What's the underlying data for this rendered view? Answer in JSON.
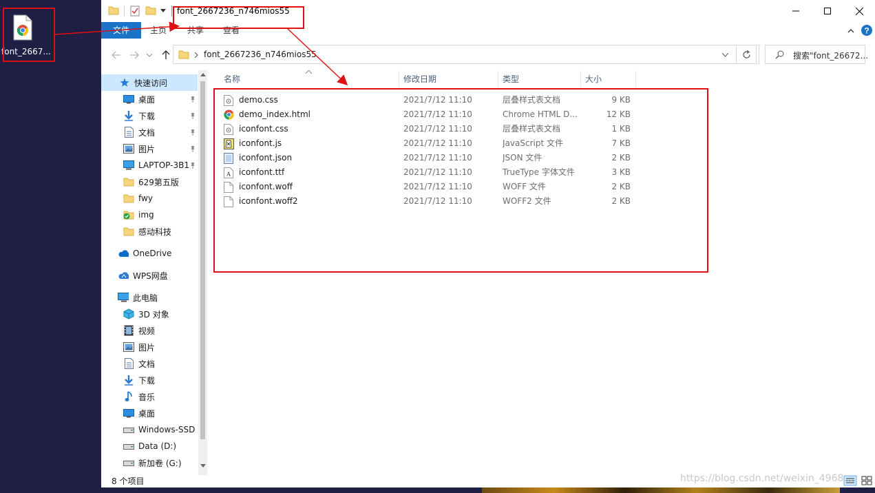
{
  "desktop": {
    "icon_label": "font_2667..."
  },
  "window": {
    "title": "font_2667236_n746mios55",
    "ribbon_tabs": [
      "文件",
      "主页",
      "共享",
      "查看"
    ],
    "address_path": "font_2667236_n746mios55",
    "search_placeholder": "搜索\"font_26672...",
    "nav_items": [
      {
        "label": "快速访问",
        "icon": "star-icon"
      },
      {
        "label": "桌面",
        "icon": "desktop-icon"
      },
      {
        "label": "下载",
        "icon": "download-icon"
      },
      {
        "label": "文档",
        "icon": "document-icon"
      },
      {
        "label": "图片",
        "icon": "picture-icon"
      },
      {
        "label": "LAPTOP-3B1",
        "icon": "computer-icon"
      },
      {
        "label": "629第五版",
        "icon": "folder-icon"
      },
      {
        "label": "fwy",
        "icon": "folder-icon"
      },
      {
        "label": "img",
        "icon": "folder-check-icon"
      },
      {
        "label": "感动科技",
        "icon": "folder-icon"
      },
      {
        "label": "OneDrive",
        "icon": "cloud-icon"
      },
      {
        "label": "WPS网盘",
        "icon": "wps-cloud-icon"
      },
      {
        "label": "此电脑",
        "icon": "pc-icon"
      },
      {
        "label": "3D 对象",
        "icon": "cube-icon"
      },
      {
        "label": "视频",
        "icon": "video-icon"
      },
      {
        "label": "图片",
        "icon": "picture-icon"
      },
      {
        "label": "文档",
        "icon": "document-icon"
      },
      {
        "label": "下载",
        "icon": "download-icon"
      },
      {
        "label": "音乐",
        "icon": "music-icon"
      },
      {
        "label": "桌面",
        "icon": "desktop-icon"
      },
      {
        "label": "Windows-SSD",
        "icon": "drive-icon"
      },
      {
        "label": "Data (D:)",
        "icon": "drive-icon"
      },
      {
        "label": "新加卷 (G:)",
        "icon": "drive-icon"
      }
    ],
    "columns": [
      "名称",
      "修改日期",
      "类型",
      "大小"
    ],
    "files": [
      {
        "name": "demo.css",
        "date": "2021/7/12 11:10",
        "type": "层叠样式表文档",
        "size": "9 KB",
        "icon": "css-file-icon"
      },
      {
        "name": "demo_index.html",
        "date": "2021/7/12 11:10",
        "type": "Chrome HTML D...",
        "size": "12 KB",
        "icon": "chrome-html-icon"
      },
      {
        "name": "iconfont.css",
        "date": "2021/7/12 11:10",
        "type": "层叠样式表文档",
        "size": "1 KB",
        "icon": "css-file-icon"
      },
      {
        "name": "iconfont.js",
        "date": "2021/7/12 11:10",
        "type": "JavaScript 文件",
        "size": "7 KB",
        "icon": "js-file-icon"
      },
      {
        "name": "iconfont.json",
        "date": "2021/7/12 11:10",
        "type": "JSON 文件",
        "size": "2 KB",
        "icon": "json-file-icon"
      },
      {
        "name": "iconfont.ttf",
        "date": "2021/7/12 11:10",
        "type": "TrueType 字体文件",
        "size": "3 KB",
        "icon": "ttf-file-icon"
      },
      {
        "name": "iconfont.woff",
        "date": "2021/7/12 11:10",
        "type": "WOFF 文件",
        "size": "2 KB",
        "icon": "blank-file-icon"
      },
      {
        "name": "iconfont.woff2",
        "date": "2021/7/12 11:10",
        "type": "WOFF2 文件",
        "size": "2 KB",
        "icon": "blank-file-icon"
      }
    ],
    "status_text": "8 个项目",
    "watermark": "https://blog.csdn.net/weixin_4968..."
  },
  "colors": {
    "accent": "#1a73c6",
    "annotation": "#e01010",
    "selected": "#cce8ff",
    "desktop": "#1f1e44"
  }
}
